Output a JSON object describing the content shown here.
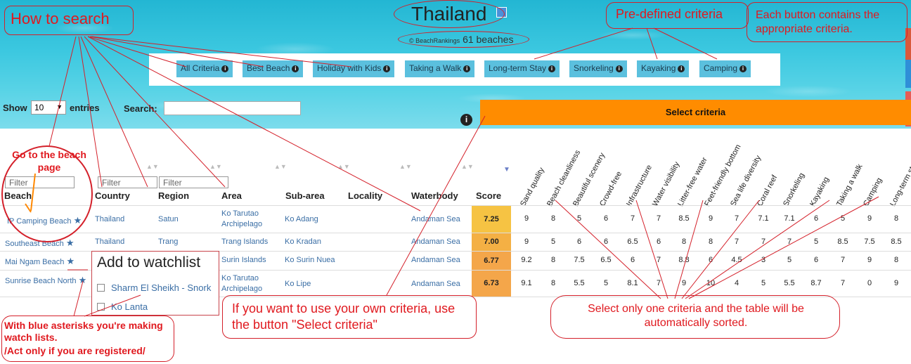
{
  "header": {
    "title": "Thailand",
    "copyright": "© BeachRankings",
    "beach_count": "61 beaches"
  },
  "criteria_buttons": [
    "All Criteria",
    "Best Beach",
    "Holiday with Kids",
    "Taking a Walk",
    "Long-term Stay",
    "Snorkeling",
    "Kayaking",
    "Camping"
  ],
  "controls": {
    "show_label": "Show",
    "entries_value": "10",
    "entries_label": "entries",
    "search_label": "Search:",
    "select_criteria": "Select criteria",
    "filter_placeholder": "Filter"
  },
  "columns": [
    "Beach",
    "Country",
    "Region",
    "Area",
    "Sub-area",
    "Locality",
    "Waterbody",
    "Score"
  ],
  "criteria_columns": [
    "Sand quality",
    "Beach cleanliness",
    "Beautiful scenery",
    "Crowd-free",
    "Infrastructure",
    "Water visibility",
    "Litter-free water",
    "Feet-friendly bottom",
    "Sea life diversity",
    "Coral reef",
    "Snorkeling",
    "Kayaking",
    "Taking a walk",
    "Camping",
    "Long-term stay"
  ],
  "rows": [
    {
      "beach": "IP Camping Beach",
      "country": "Thailand",
      "region": "Satun",
      "area": "Ko Tarutao Archipelago",
      "subarea": "Ko Adang",
      "waterbody": "Andaman Sea",
      "score": "7.25",
      "score_color": "#f6c343",
      "vals": [
        "9",
        "8",
        "5",
        "6",
        "7",
        "7",
        "8.5",
        "9",
        "7",
        "7.1",
        "7.1",
        "6",
        "5",
        "9",
        "8"
      ]
    },
    {
      "beach": "Southeast Beach",
      "country": "Thailand",
      "region": "Trang",
      "area": "Trang Islands",
      "subarea": "Ko Kradan",
      "waterbody": "Andaman Sea",
      "score": "7.00",
      "score_color": "#f4b044",
      "vals": [
        "9",
        "5",
        "6",
        "6",
        "6.5",
        "6",
        "8",
        "8",
        "7",
        "7",
        "7",
        "5",
        "8.5",
        "7.5",
        "8.5"
      ]
    },
    {
      "beach": "Mai Ngam Beach",
      "country": "",
      "region": "",
      "area": "Surin Islands",
      "subarea": "Ko Surin Nuea",
      "waterbody": "Andaman Sea",
      "score": "6.77",
      "score_color": "#f4a64a",
      "vals": [
        "9.2",
        "8",
        "7.5",
        "6.5",
        "6",
        "7",
        "8.8",
        "6",
        "4.5",
        "3",
        "5",
        "6",
        "7",
        "9",
        "8"
      ]
    },
    {
      "beach": "Sunrise Beach North",
      "country": "",
      "region": "",
      "area": "Ko Tarutao Archipelago",
      "subarea": "Ko Lipe",
      "waterbody": "Andaman Sea",
      "score": "6.73",
      "score_color": "#f4a64a",
      "vals": [
        "9.1",
        "8",
        "5.5",
        "5",
        "8.1",
        "7",
        "9",
        "10",
        "4",
        "5",
        "5.5",
        "8.7",
        "7",
        "0",
        "9"
      ]
    }
  ],
  "watchlist": {
    "title": "Add to watchlist",
    "items": [
      "Sharm El Sheikh - Snork",
      "Ko Lanta"
    ]
  },
  "annotations": {
    "how_to_search": "How to search",
    "predefined": "Pre-defined criteria",
    "each_button": "Each button contains the appropriate criteria.",
    "go_to": "Go to the beach page",
    "own_criteria": "If you want to use your own criteria, use the button \"Select criteria\"",
    "select_one": "Select only one criteria and the table will be automatically sorted.",
    "asterisks": "With blue asterisks you're making watch lists.",
    "registered": "/Act only if you are registered/"
  }
}
